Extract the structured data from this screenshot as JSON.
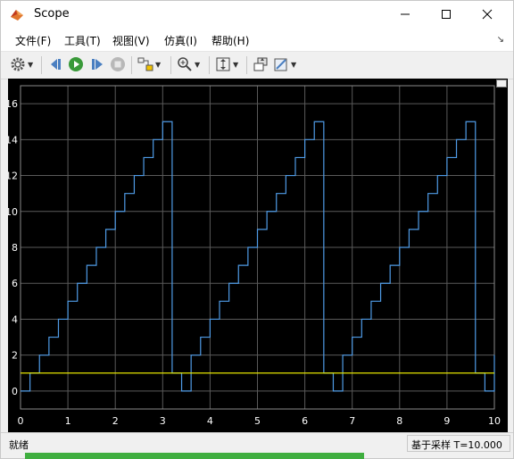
{
  "window": {
    "title": "Scope",
    "controls": {
      "minimize": "minimize",
      "maximize": "maximize",
      "close": "close"
    }
  },
  "menu": {
    "items": [
      "文件(F)",
      "工具(T)",
      "视图(V)",
      "仿真(I)",
      "帮助(H)"
    ]
  },
  "toolbar": {
    "icons": [
      "gear-icon",
      "step-back-icon",
      "run-icon",
      "step-forward-icon",
      "stop-icon",
      "highlight-block-icon",
      "zoom-in-icon",
      "autoscale-icon",
      "restore-layout-icon",
      "edit-style-icon"
    ]
  },
  "status": {
    "left": "就绪",
    "right": "基于采样  T=10.000"
  },
  "colors": {
    "signal_line": "#4f9be6",
    "constant_line": "#e6e600",
    "grid": "#5a5a5a",
    "axes_text": "#ffffff",
    "plot_bg": "#000000"
  },
  "chart_data": {
    "type": "line",
    "title": "",
    "xlabel": "",
    "ylabel": "",
    "xlim": [
      0,
      10
    ],
    "ylim": [
      -1,
      17
    ],
    "x_ticks": [
      "0",
      "1",
      "2",
      "3",
      "4",
      "5",
      "6",
      "7",
      "8",
      "9",
      "10"
    ],
    "y_ticks": [
      "0",
      "2",
      "4",
      "6",
      "8",
      "10",
      "12",
      "14",
      "16"
    ],
    "grid": true,
    "legend": "none",
    "series": [
      {
        "style": "stairs",
        "color": "#4f9be6",
        "x": [
          0,
          0.2,
          0.4,
          0.6,
          0.8,
          1.0,
          1.2,
          1.4,
          1.6,
          1.8,
          2.0,
          2.2,
          2.4,
          2.6,
          2.8,
          3.0,
          3.2,
          3.4,
          3.6,
          3.8,
          4.0,
          4.2,
          4.4,
          4.6,
          4.8,
          5.0,
          5.2,
          5.4,
          5.6,
          5.8,
          6.0,
          6.2,
          6.4,
          6.6,
          6.8,
          7.0,
          7.2,
          7.4,
          7.6,
          7.8,
          8.0,
          8.2,
          8.4,
          8.6,
          8.8,
          9.0,
          9.2,
          9.4,
          9.6,
          9.8,
          10.0
        ],
        "y": [
          0,
          1,
          2,
          3,
          4,
          5,
          6,
          7,
          8,
          9,
          10,
          11,
          12,
          13,
          14,
          15,
          1,
          0,
          2,
          3,
          4,
          5,
          6,
          7,
          8,
          9,
          10,
          11,
          12,
          13,
          14,
          15,
          1,
          0,
          2,
          3,
          4,
          5,
          6,
          7,
          8,
          9,
          10,
          11,
          12,
          13,
          14,
          15,
          1,
          0,
          2
        ]
      },
      {
        "style": "line",
        "color": "#e6e600",
        "x": [
          0,
          10
        ],
        "y": [
          1,
          1
        ]
      }
    ]
  }
}
